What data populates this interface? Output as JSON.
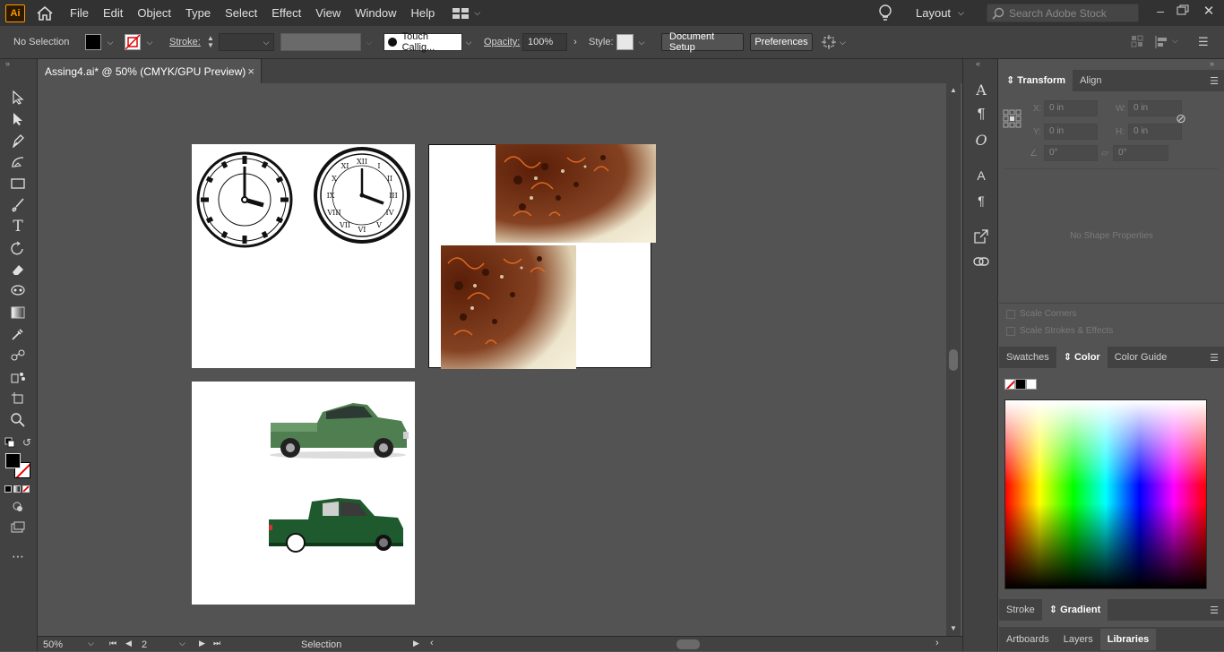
{
  "app": {
    "logo": "Ai"
  },
  "menu": [
    "File",
    "Edit",
    "Object",
    "Type",
    "Select",
    "Effect",
    "View",
    "Window",
    "Help"
  ],
  "workspace": {
    "label": "Layout"
  },
  "search": {
    "placeholder": "Search Adobe Stock"
  },
  "control": {
    "selection": "No Selection",
    "stroke_label": "Stroke:",
    "brush": "Touch Callig...",
    "opacity_label": "Opacity:",
    "opacity_value": "100%",
    "style_label": "Style:",
    "doc_setup": "Document Setup",
    "preferences": "Preferences"
  },
  "document": {
    "tab_title": "Assing4.ai* @ 50% (CMYK/GPU Preview)",
    "close": "×"
  },
  "status": {
    "zoom": "50%",
    "artboard_num": "2",
    "tool": "Selection"
  },
  "transform_panel": {
    "tabs": [
      "Transform",
      "Align"
    ],
    "x_label": "X:",
    "y_label": "Y:",
    "w_label": "W:",
    "h_label": "H:",
    "x": "0 in",
    "y": "0 in",
    "w": "0 in",
    "h": "0 in",
    "angle": "0°",
    "shear": "0°",
    "no_shape": "No Shape Properties",
    "scale_corners": "Scale Corners",
    "scale_strokes": "Scale Strokes & Effects"
  },
  "color_panel": {
    "tabs": [
      "Swatches",
      "Color",
      "Color Guide"
    ]
  },
  "gradient_panel": {
    "tabs": [
      "Stroke",
      "Gradient"
    ]
  },
  "bottom_panel": {
    "tabs": [
      "Artboards",
      "Layers",
      "Libraries"
    ]
  },
  "colors": {
    "accent": "#ff9a00",
    "ui_dark": "#323232",
    "ui_mid": "#424242",
    "canvas": "#535353",
    "truck_green": "#4a7a4a",
    "ornament": "#6b2a0a"
  }
}
